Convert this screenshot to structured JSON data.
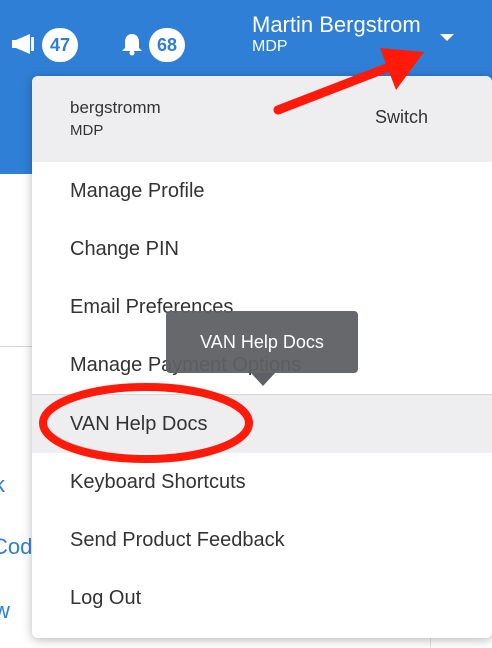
{
  "header": {
    "announcements_count": "47",
    "notifications_count": "68",
    "user_name": "Martin Bergstrom",
    "user_org": "MDP",
    "icons": {
      "announcements": "megaphone-icon",
      "notifications": "bell-icon",
      "menu_toggle": "caret-down-icon"
    },
    "colors": {
      "header_bg": "#2f7fd6",
      "badge_text": "#2f7fd6"
    }
  },
  "dropdown": {
    "account": {
      "username": "bergstromm",
      "org": "MDP",
      "switch_label": "Switch"
    },
    "items": [
      {
        "label": "Manage Profile"
      },
      {
        "label": "Change PIN"
      },
      {
        "label": "Email Preferences"
      },
      {
        "label": "Manage Payment Options"
      },
      {
        "label": "VAN Help Docs"
      },
      {
        "label": "Keyboard Shortcuts"
      },
      {
        "label": "Send Product Feedback"
      },
      {
        "label": "Log Out"
      }
    ]
  },
  "tooltip": {
    "text": "VAN Help Docs"
  },
  "background": {
    "link_fragments": [
      "k",
      "Cod",
      "w"
    ]
  },
  "annotations": {
    "color": "#ff1a0a"
  }
}
